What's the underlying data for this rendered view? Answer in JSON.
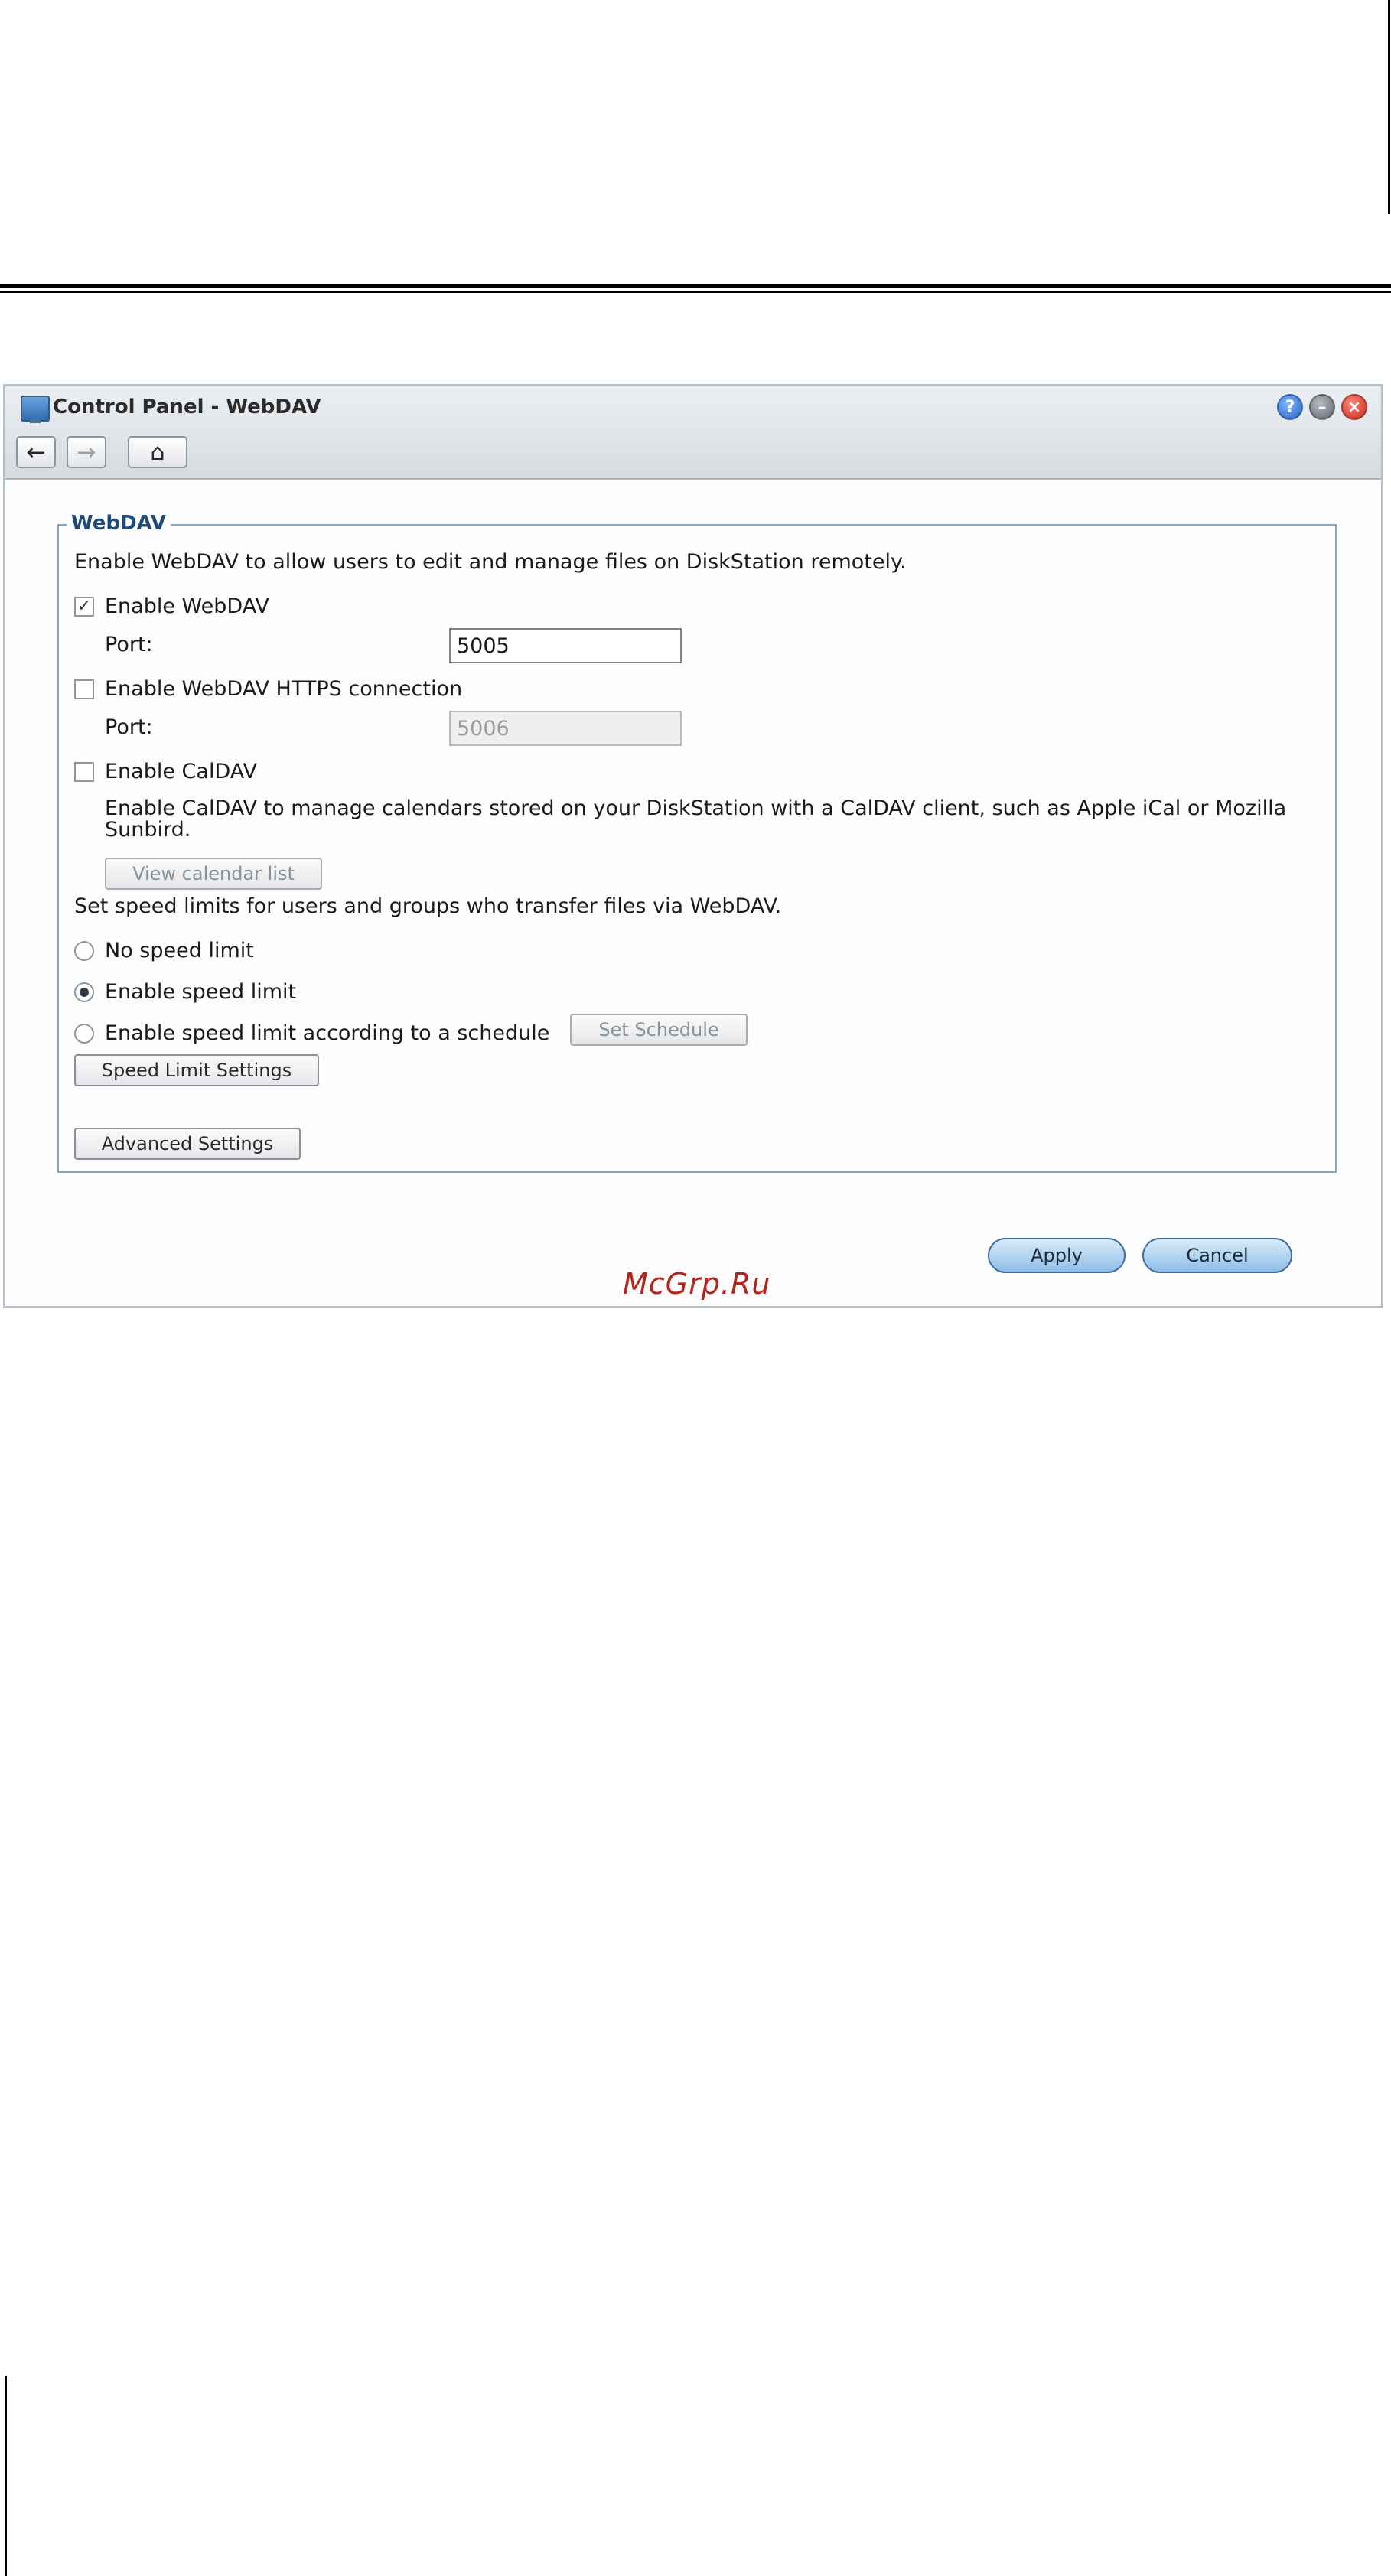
{
  "window": {
    "title": "Control Panel - WebDAV",
    "controls": {
      "help": "?",
      "minimize": "–",
      "close": "×"
    }
  },
  "toolbar": {
    "back_icon": "←",
    "forward_icon": "→",
    "home_icon": "⌂"
  },
  "webdav": {
    "legend": "WebDAV",
    "intro": "Enable WebDAV to allow users to edit and manage files on DiskStation remotely.",
    "enable_webdav": {
      "label": "Enable WebDAV",
      "checked": true,
      "mark": "✓"
    },
    "port_label": "Port:",
    "port_value": "5005",
    "enable_https": {
      "label": "Enable WebDAV HTTPS connection",
      "checked": false
    },
    "https_port_label": "Port:",
    "https_port_value": "5006",
    "enable_caldav": {
      "label": "Enable CalDAV",
      "checked": false
    },
    "caldav_description_line1": "Enable CalDAV to manage calendars stored on your DiskStation with a CalDAV client, such as Apple iCal or Mozilla",
    "caldav_description_line2": "Sunbird.",
    "view_calendar_button": "View calendar list",
    "speed_intro": "Set speed limits for users and groups who transfer files via WebDAV.",
    "speed_options": [
      {
        "label": "No speed limit",
        "selected": false
      },
      {
        "label": "Enable speed limit",
        "selected": true
      },
      {
        "label": "Enable speed limit according to a schedule",
        "selected": false
      }
    ],
    "set_schedule_button": "Set Schedule",
    "speed_limit_settings_button": "Speed Limit Settings",
    "advanced_settings_button": "Advanced Settings"
  },
  "footer": {
    "apply": "Apply",
    "cancel": "Cancel"
  },
  "watermark": "McGrp.Ru"
}
